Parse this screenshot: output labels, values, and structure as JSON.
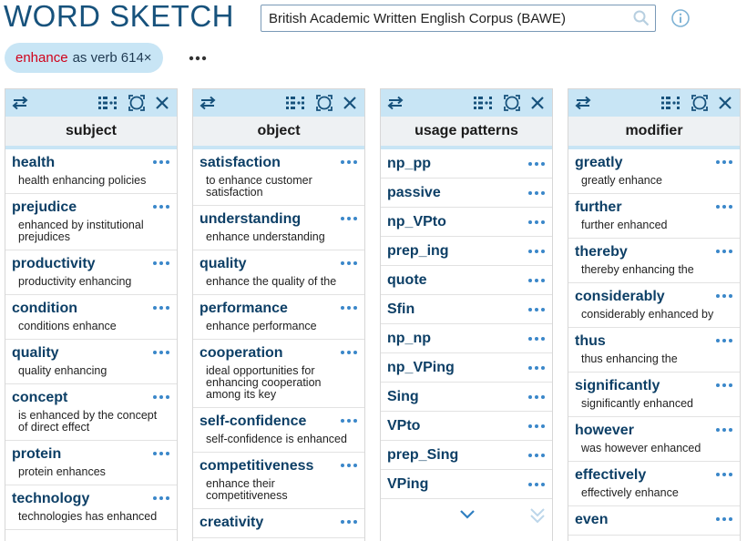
{
  "title": "WORD SKETCH",
  "search": {
    "corpus": "British Academic Written English Corpus (BAWE)"
  },
  "chip": {
    "headword": "enhance",
    "pos": "as verb",
    "count": "614×"
  },
  "columns": [
    {
      "header": "subject",
      "items": [
        {
          "word": "health",
          "example": "health enhancing policies"
        },
        {
          "word": "prejudice",
          "example": "enhanced by institutional prejudices"
        },
        {
          "word": "productivity",
          "example": "productivity enhancing"
        },
        {
          "word": "condition",
          "example": "conditions enhance"
        },
        {
          "word": "quality",
          "example": "quality enhancing"
        },
        {
          "word": "concept",
          "example": "is enhanced by the concept of direct effect"
        },
        {
          "word": "protein",
          "example": "protein enhances"
        },
        {
          "word": "technology",
          "example": "technologies has enhanced"
        }
      ]
    },
    {
      "header": "object",
      "items": [
        {
          "word": "satisfaction",
          "example": "to enhance customer satisfaction"
        },
        {
          "word": "understanding",
          "example": "enhance understanding"
        },
        {
          "word": "quality",
          "example": "enhance the quality of the"
        },
        {
          "word": "performance",
          "example": "enhance performance"
        },
        {
          "word": "cooperation",
          "example": "ideal opportunities for enhancing cooperation among its key"
        },
        {
          "word": "self-confidence",
          "example": "self-confidence is enhanced"
        },
        {
          "word": "competitiveness",
          "example": "enhance their competitiveness"
        },
        {
          "word": "creativity",
          "example": ""
        }
      ]
    },
    {
      "header": "usage patterns",
      "patterns": [
        "np_pp",
        "passive",
        "np_VPto",
        "prep_ing",
        "quote",
        "Sfin",
        "np_np",
        "np_VPing",
        "Sing",
        "VPto",
        "prep_Sing",
        "VPing"
      ]
    },
    {
      "header": "modifier",
      "items": [
        {
          "word": "greatly",
          "example": "greatly enhance"
        },
        {
          "word": "further",
          "example": "further enhanced"
        },
        {
          "word": "thereby",
          "example": "thereby enhancing the"
        },
        {
          "word": "considerably",
          "example": "considerably enhanced by"
        },
        {
          "word": "thus",
          "example": "thus enhancing the"
        },
        {
          "word": "significantly",
          "example": "significantly enhanced"
        },
        {
          "word": "however",
          "example": "was however enhanced"
        },
        {
          "word": "effectively",
          "example": "effectively enhance"
        },
        {
          "word": "even",
          "example": ""
        }
      ]
    }
  ],
  "icons": {
    "swap": "swap-arrows-icon",
    "grid": "grid-toggle-icon",
    "frame": "fit-view-icon",
    "close": "close-icon",
    "more": "more-dots-icon",
    "search": "search-icon",
    "info": "info-icon",
    "next": "chevron-down-icon",
    "last": "double-chevron-down-icon"
  },
  "colors": {
    "accent": "#17527c",
    "toolbar": "#c8e5f5",
    "headword": "#d0021b",
    "link": "#0d3f66",
    "dots": "#3a87c9"
  }
}
